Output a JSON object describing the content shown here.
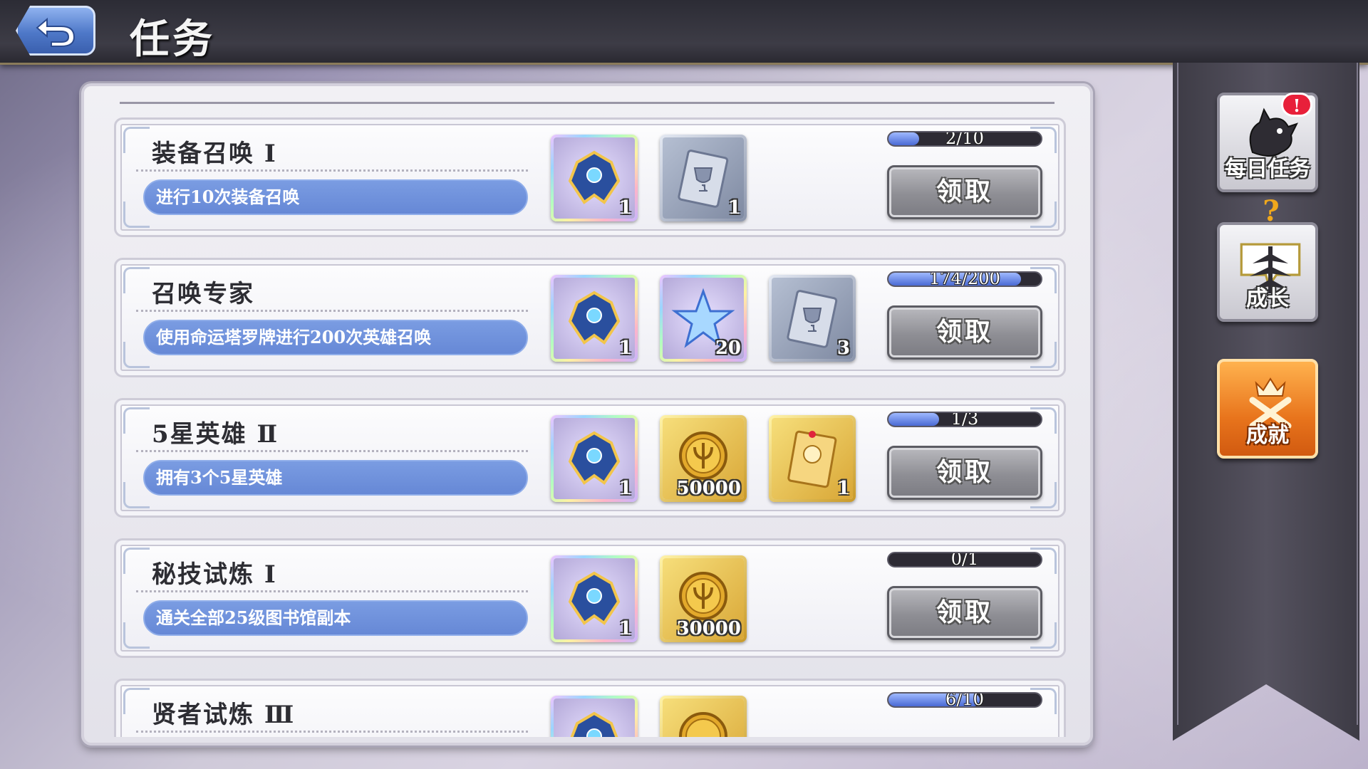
{
  "header": {
    "title": "任务"
  },
  "sidebar": {
    "items": [
      {
        "label": "每日任务",
        "icon": "daily-dragon-icon",
        "badge": "!"
      },
      {
        "label": "成长",
        "icon": "growth-icon",
        "badge": "?"
      },
      {
        "label": "成就",
        "icon": "achievement-crown-icon"
      }
    ]
  },
  "quests": [
    {
      "title": "装备召唤 Ⅰ",
      "desc": "进行10次装备召唤",
      "progress_text": "2/10",
      "progress": 0.2,
      "claim": "领取",
      "rewards": [
        {
          "icon": "rainbow-helmet-icon",
          "qty": "1"
        },
        {
          "icon": "silver-trophy-card-icon",
          "qty": "1"
        }
      ]
    },
    {
      "title": "召唤专家",
      "desc": "使用命运塔罗牌进行200次英雄召唤",
      "progress_text": "174/200",
      "progress": 0.87,
      "claim": "领取",
      "rewards": [
        {
          "icon": "rainbow-helmet-icon",
          "qty": "1"
        },
        {
          "icon": "crystal-star-icon",
          "qty": "20"
        },
        {
          "icon": "silver-trophy-card-icon",
          "qty": "3"
        }
      ]
    },
    {
      "title": "5星英雄 Ⅱ",
      "desc": "拥有3个5星英雄",
      "progress_text": "1/3",
      "progress": 0.33,
      "claim": "领取",
      "rewards": [
        {
          "icon": "rainbow-helmet-icon",
          "qty": "1"
        },
        {
          "icon": "gold-coin-icon",
          "qty": "50000"
        },
        {
          "icon": "gold-hero-card-icon",
          "qty": "1"
        }
      ]
    },
    {
      "title": "秘技试炼 Ⅰ",
      "desc": "通关全部25级图书馆副本",
      "progress_text": "0/1",
      "progress": 0,
      "claim": "领取",
      "rewards": [
        {
          "icon": "rainbow-helmet-icon",
          "qty": "1"
        },
        {
          "icon": "gold-coin-icon",
          "qty": "30000"
        }
      ]
    },
    {
      "title": "贤者试炼 Ⅲ",
      "progress_text": "6/10",
      "progress": 0.6,
      "rewards": [
        {
          "icon": "rainbow-helmet-icon"
        },
        {
          "icon": "gold-coin-icon"
        }
      ]
    }
  ],
  "colors": {
    "progress_fill": "#4a6ad4",
    "desc_pill": "#6688d6",
    "active_tab": "#e8741c"
  }
}
